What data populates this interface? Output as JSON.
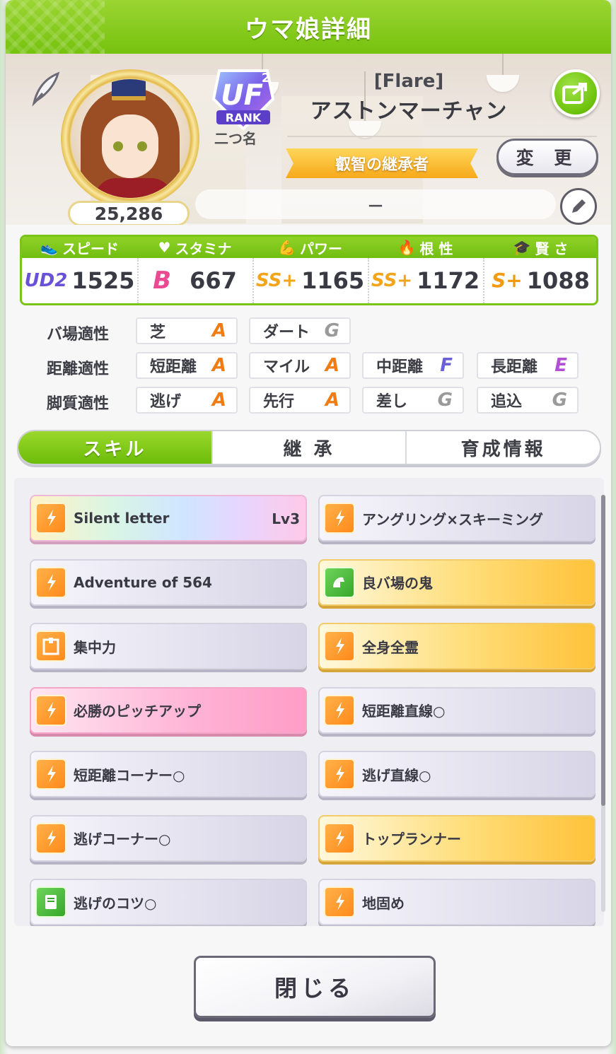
{
  "title": "ウマ娘詳細",
  "profile": {
    "fans": "25,286",
    "rank_label": "二つ名",
    "rank_badge": "UF2 RANK",
    "name_sub": "[Flare]",
    "name": "アストンマーチャン",
    "epithet": "叡智の継承者",
    "change_label": "変 更",
    "trainer_comment": "－"
  },
  "stats": [
    {
      "label": "スピード",
      "grade": "UD2",
      "value": "1525"
    },
    {
      "label": "スタミナ",
      "grade": "B",
      "value": "667"
    },
    {
      "label": "パワー",
      "grade": "SS+",
      "value": "1165"
    },
    {
      "label": "根 性",
      "grade": "SS+",
      "value": "1172"
    },
    {
      "label": "賢 さ",
      "grade": "S+",
      "value": "1088"
    }
  ],
  "aptitudes": {
    "track": {
      "label": "バ場適性",
      "items": [
        {
          "name": "芝",
          "grade": "A"
        },
        {
          "name": "ダート",
          "grade": "G"
        }
      ]
    },
    "distance": {
      "label": "距離適性",
      "items": [
        {
          "name": "短距離",
          "grade": "A"
        },
        {
          "name": "マイル",
          "grade": "A"
        },
        {
          "name": "中距離",
          "grade": "F"
        },
        {
          "name": "長距離",
          "grade": "E"
        }
      ]
    },
    "style": {
      "label": "脚質適性",
      "items": [
        {
          "name": "逃げ",
          "grade": "A"
        },
        {
          "name": "先行",
          "grade": "A"
        },
        {
          "name": "差し",
          "grade": "G"
        },
        {
          "name": "追込",
          "grade": "G"
        }
      ]
    }
  },
  "tabs": [
    "スキル",
    "継 承",
    "育成情報"
  ],
  "skills": [
    {
      "name": "Silent letter",
      "level": "Lv3",
      "style": "rainbow",
      "icon": "speed-icon"
    },
    {
      "name": "アングリング×スキーミング",
      "style": "normal",
      "icon": "speed-icon"
    },
    {
      "name": "Adventure of 564",
      "style": "normal",
      "icon": "speed-icon"
    },
    {
      "name": "良バ場の鬼",
      "style": "gold",
      "icon": "power-icon"
    },
    {
      "name": "集中力",
      "style": "normal",
      "icon": "gate-icon"
    },
    {
      "name": "全身全霊",
      "style": "gold",
      "icon": "speed-icon"
    },
    {
      "name": "必勝のピッチアップ",
      "style": "pink",
      "icon": "speed-icon"
    },
    {
      "name": "短距離直線○",
      "style": "normal",
      "icon": "speed-icon"
    },
    {
      "name": "短距離コーナー○",
      "style": "normal",
      "icon": "speed-icon"
    },
    {
      "name": "逃げ直線○",
      "style": "normal",
      "icon": "speed-icon"
    },
    {
      "name": "逃げコーナー○",
      "style": "normal",
      "icon": "speed-icon"
    },
    {
      "name": "トップランナー",
      "style": "gold",
      "icon": "speed-icon"
    },
    {
      "name": "逃げのコツ○",
      "style": "normal",
      "icon": "book-icon"
    },
    {
      "name": "地固め",
      "style": "normal",
      "icon": "speed-icon"
    }
  ],
  "close_label": "閉じる",
  "colors": {
    "accent_green": "#76c20e",
    "gold": "#ffc23a",
    "pink": "#ff9dc7"
  }
}
